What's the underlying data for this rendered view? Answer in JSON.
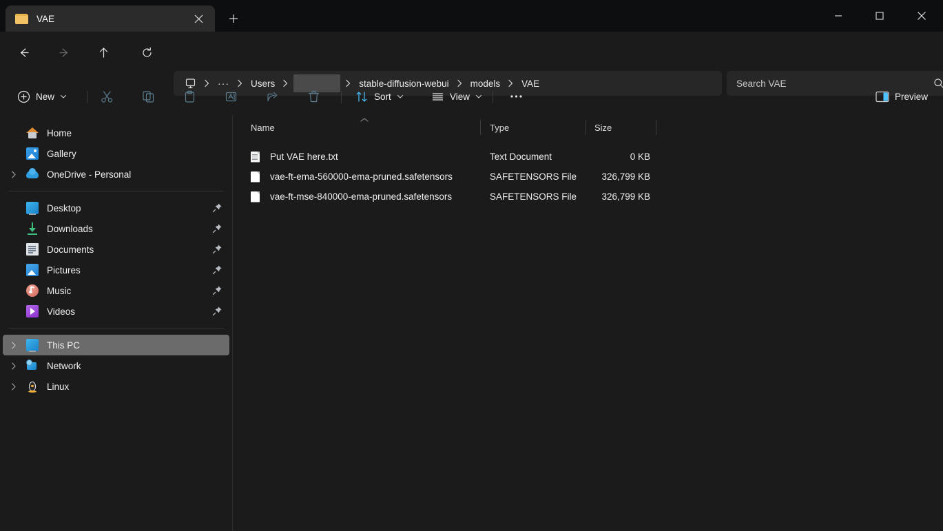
{
  "window": {
    "tab": {
      "title": "VAE",
      "folder_icon": "folder-icon",
      "close_icon": "close-icon"
    },
    "new_tab_icon": "plus-icon",
    "controls": {
      "minimize": "minimize-icon",
      "maximize": "maximize-icon",
      "close": "close-icon"
    }
  },
  "nav": {
    "back": "arrow-left-icon",
    "forward": "arrow-right-icon",
    "up": "arrow-up-icon",
    "refresh": "refresh-icon"
  },
  "address": {
    "pc_icon": "this-pc-icon",
    "overflow": "···",
    "crumbs": [
      {
        "label": "Users",
        "redacted": false
      },
      {
        "label": "",
        "redacted": true
      },
      {
        "label": "stable-diffusion-webui",
        "redacted": false
      },
      {
        "label": "models",
        "redacted": false
      },
      {
        "label": "VAE",
        "redacted": false
      }
    ]
  },
  "search": {
    "placeholder": "Search VAE",
    "icon": "search-icon"
  },
  "toolbar": {
    "new_label": "New",
    "new_icon": "plus-circle-icon",
    "cut_icon": "scissors-icon",
    "copy_icon": "copy-icon",
    "paste_icon": "paste-icon",
    "rename_icon": "rename-icon",
    "share_icon": "share-icon",
    "delete_icon": "trash-icon",
    "sort_label": "Sort",
    "sort_icon": "sort-arrows-icon",
    "view_label": "View",
    "view_icon": "view-lines-icon",
    "more_icon": "ellipsis-icon",
    "preview_label": "Preview",
    "preview_icon": "preview-pane-icon"
  },
  "sidebar": {
    "groups": [
      {
        "items": [
          {
            "label": "Home",
            "icon": "home-icon",
            "expandable": false,
            "pinned": false,
            "selected": false
          },
          {
            "label": "Gallery",
            "icon": "gallery-icon",
            "expandable": false,
            "pinned": false,
            "selected": false
          },
          {
            "label": "OneDrive - Personal",
            "icon": "onedrive-cloud-icon",
            "expandable": true,
            "pinned": false,
            "selected": false
          }
        ]
      },
      {
        "items": [
          {
            "label": "Desktop",
            "icon": "desktop-icon",
            "expandable": false,
            "pinned": true,
            "selected": false
          },
          {
            "label": "Downloads",
            "icon": "downloads-icon",
            "expandable": false,
            "pinned": true,
            "selected": false
          },
          {
            "label": "Documents",
            "icon": "documents-icon",
            "expandable": false,
            "pinned": true,
            "selected": false
          },
          {
            "label": "Pictures",
            "icon": "pictures-icon",
            "expandable": false,
            "pinned": true,
            "selected": false
          },
          {
            "label": "Music",
            "icon": "music-icon",
            "expandable": false,
            "pinned": true,
            "selected": false
          },
          {
            "label": "Videos",
            "icon": "videos-icon",
            "expandable": false,
            "pinned": true,
            "selected": false
          }
        ]
      },
      {
        "items": [
          {
            "label": "This PC",
            "icon": "this-pc-icon",
            "expandable": true,
            "pinned": false,
            "selected": true
          },
          {
            "label": "Network",
            "icon": "network-icon",
            "expandable": true,
            "pinned": false,
            "selected": false
          },
          {
            "label": "Linux",
            "icon": "linux-penguin-icon",
            "expandable": true,
            "pinned": false,
            "selected": false
          }
        ]
      }
    ]
  },
  "filelist": {
    "columns": [
      {
        "key": "name",
        "label": "Name",
        "sorted": "asc"
      },
      {
        "key": "type",
        "label": "Type",
        "sorted": ""
      },
      {
        "key": "size",
        "label": "Size",
        "sorted": ""
      }
    ],
    "rows": [
      {
        "name": "Put VAE here.txt",
        "type": "Text Document",
        "size": "0 KB",
        "icon": "text-file-icon"
      },
      {
        "name": "vae-ft-ema-560000-ema-pruned.safetensors",
        "type": "SAFETENSORS File",
        "size": "326,799 KB",
        "icon": "generic-file-icon"
      },
      {
        "name": "vae-ft-mse-840000-ema-pruned.safetensors",
        "type": "SAFETENSORS File",
        "size": "326,799 KB",
        "icon": "generic-file-icon"
      }
    ]
  },
  "colors": {
    "titlebar_bg": "#0c0e10",
    "window_bg": "#1b1b1b",
    "tab_bg": "#2b2b2b",
    "field_bg": "#272727",
    "selection_bg": "#6b6b6b",
    "accent_blue": "#4cc2ff",
    "folder_yellow": "#f3c264",
    "disabled_icon": "#5d7f92"
  }
}
